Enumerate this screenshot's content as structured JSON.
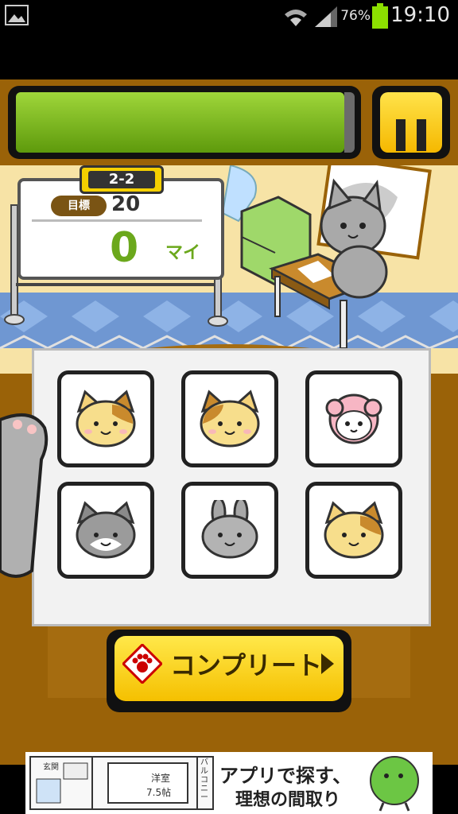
{
  "status_bar": {
    "battery": "76%",
    "time": "19:10"
  },
  "hud": {
    "time_fraction": 0.97
  },
  "board": {
    "stage": "2-2",
    "goal_label": "目標",
    "goal_value": "20",
    "score": "0",
    "score_unit": "マイ"
  },
  "grid": {
    "tiles": [
      {
        "animal": "calico-cat"
      },
      {
        "animal": "calico-cat"
      },
      {
        "animal": "pink-sheep"
      },
      {
        "animal": "gray-tabby-cat"
      },
      {
        "animal": "gray-rabbit"
      },
      {
        "animal": "calico-cat"
      }
    ]
  },
  "complete_button": {
    "label": "コンプリート"
  },
  "ad": {
    "line1": "アプリで探す、",
    "line2": "理想の間取り",
    "room_label": "洋室",
    "room_size": "7.5帖",
    "balcony": "バルコニー",
    "entrance": "玄関"
  },
  "colors": {
    "accent_yellow": "#f5c000",
    "timer_green": "#6ba81c",
    "frame_brown": "#9a6208"
  }
}
